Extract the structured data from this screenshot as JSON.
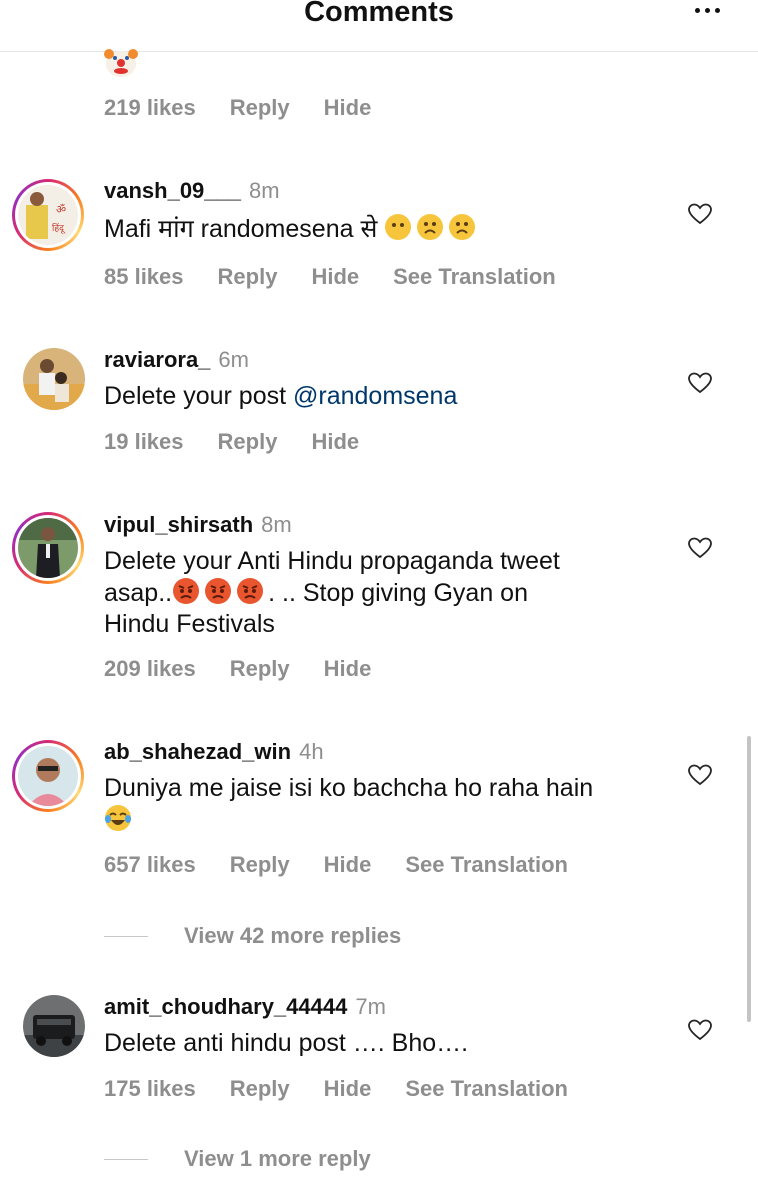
{
  "header": {
    "title": "Comments",
    "more_icon": "more-horizontal-icon"
  },
  "top_comment": {
    "likes": "219 likes",
    "reply": "Reply",
    "hide": "Hide",
    "emoji_icon": "clown-face-icon"
  },
  "comments": [
    {
      "username": "vansh_09___",
      "time": "8m",
      "text": "Mafi मांग randomesena से",
      "likes": "85 likes",
      "reply": "Reply",
      "hide": "Hide",
      "translate": "See Translation"
    },
    {
      "username": "raviarora_",
      "time": "6m",
      "text_before": "Delete your post ",
      "mention": "@randomsena",
      "likes": "19 likes",
      "reply": "Reply",
      "hide": "Hide"
    },
    {
      "username": "vipul_shirsath",
      "time": "8m",
      "line1": "Delete your Anti Hindu propaganda tweet",
      "line2_prefix": "asap..",
      "line2_suffix": ". .. Stop giving Gyan on",
      "line3": "Hindu Festivals",
      "likes": "209 likes",
      "reply": "Reply",
      "hide": "Hide"
    },
    {
      "username": "ab_shahezad_win",
      "time": "4h",
      "text": "Duniya me jaise isi ko bachcha ho raha hain",
      "likes": "657 likes",
      "reply": "Reply",
      "hide": "Hide",
      "translate": "See Translation",
      "view_replies": "View 42 more replies"
    },
    {
      "username": "amit_choudhary_44444",
      "time": "7m",
      "text": "Delete anti hindu post …. Bho….",
      "likes": "175 likes",
      "reply": "Reply",
      "hide": "Hide",
      "translate": "See Translation",
      "view_replies": "View 1 more reply"
    }
  ],
  "colors": {
    "meta": "#8e8e8e",
    "mention": "#00376b",
    "divider": "#e6e6e6"
  }
}
